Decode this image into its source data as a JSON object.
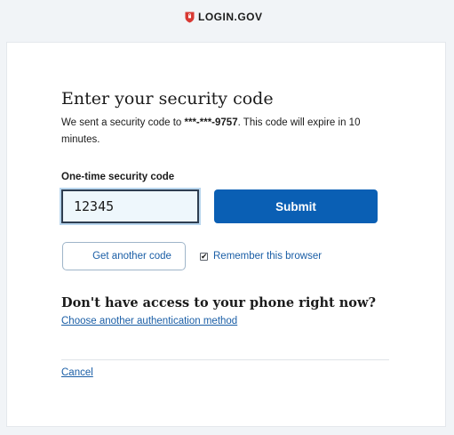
{
  "header": {
    "logo_text": "LOGIN.GOV",
    "logo_icon": "shield-icon",
    "brand_color": "#d83933"
  },
  "form": {
    "title": "Enter your security code",
    "description_prefix": "We sent a security code to ",
    "phone_masked": "***-***-9757",
    "description_suffix": ". This code will expire in 10 minutes.",
    "code_label": "One-time security code",
    "code_value": "12345",
    "submit_label": "Submit",
    "get_another_code_label": "Get another code",
    "remember_browser_label": "Remember this browser",
    "remember_browser_checked": true
  },
  "alternate": {
    "heading": "Don't have access to your phone right now?",
    "link_label": "Choose another authentication method"
  },
  "footer": {
    "cancel_label": "Cancel"
  },
  "colors": {
    "primary_button": "#0a5fb4",
    "link": "#1a5ea6",
    "page_background": "#f1f4f7"
  }
}
